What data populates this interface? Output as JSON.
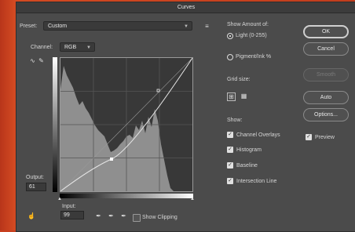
{
  "window": {
    "title": "Curves"
  },
  "preset": {
    "label": "Preset:",
    "value": "Custom"
  },
  "channel": {
    "label": "Channel:",
    "value": "RGB"
  },
  "output": {
    "label": "Output:",
    "value": "61"
  },
  "input": {
    "label": "Input:",
    "value": "99"
  },
  "show_clipping": {
    "label": "Show Clipping"
  },
  "curve_display": {
    "show_amount_heading": "Show Amount of:",
    "light_label": "Light (0-255)",
    "pigment_label": "Pigment/Ink %",
    "grid_size_heading": "Grid size:",
    "show_heading": "Show:",
    "channel_overlays": "Channel Overlays",
    "histogram": "Histogram",
    "baseline": "Baseline",
    "intersection_line": "Intersection Line"
  },
  "buttons": {
    "ok": "OK",
    "cancel": "Cancel",
    "smooth": "Smooth",
    "auto": "Auto",
    "options": "Options..."
  },
  "preview": {
    "label": "Preview",
    "checked": true
  },
  "curve": {
    "input_points": [
      0,
      99,
      255
    ],
    "output_points": [
      0,
      61,
      255
    ]
  },
  "colors": {
    "dialog_bg": "#4b4b4b",
    "graph_bg": "#383838",
    "histogram": "#8f8f8f",
    "desktop": "#c8401f"
  }
}
